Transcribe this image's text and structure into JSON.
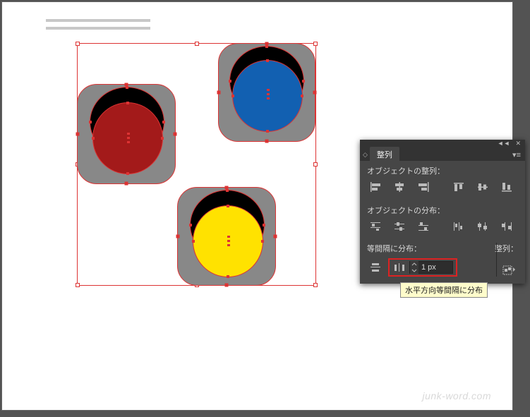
{
  "panel": {
    "title": "整列",
    "align_section_label": "オブジェクトの整列：",
    "distribute_section_label": "オブジェクトの分布：",
    "spacing_section_label": "等間隔に分布：",
    "align_to_label": "整列：",
    "spacing_value": "1 px"
  },
  "tooltip": "水平方向等間隔に分布",
  "watermark": "junk-word.com"
}
